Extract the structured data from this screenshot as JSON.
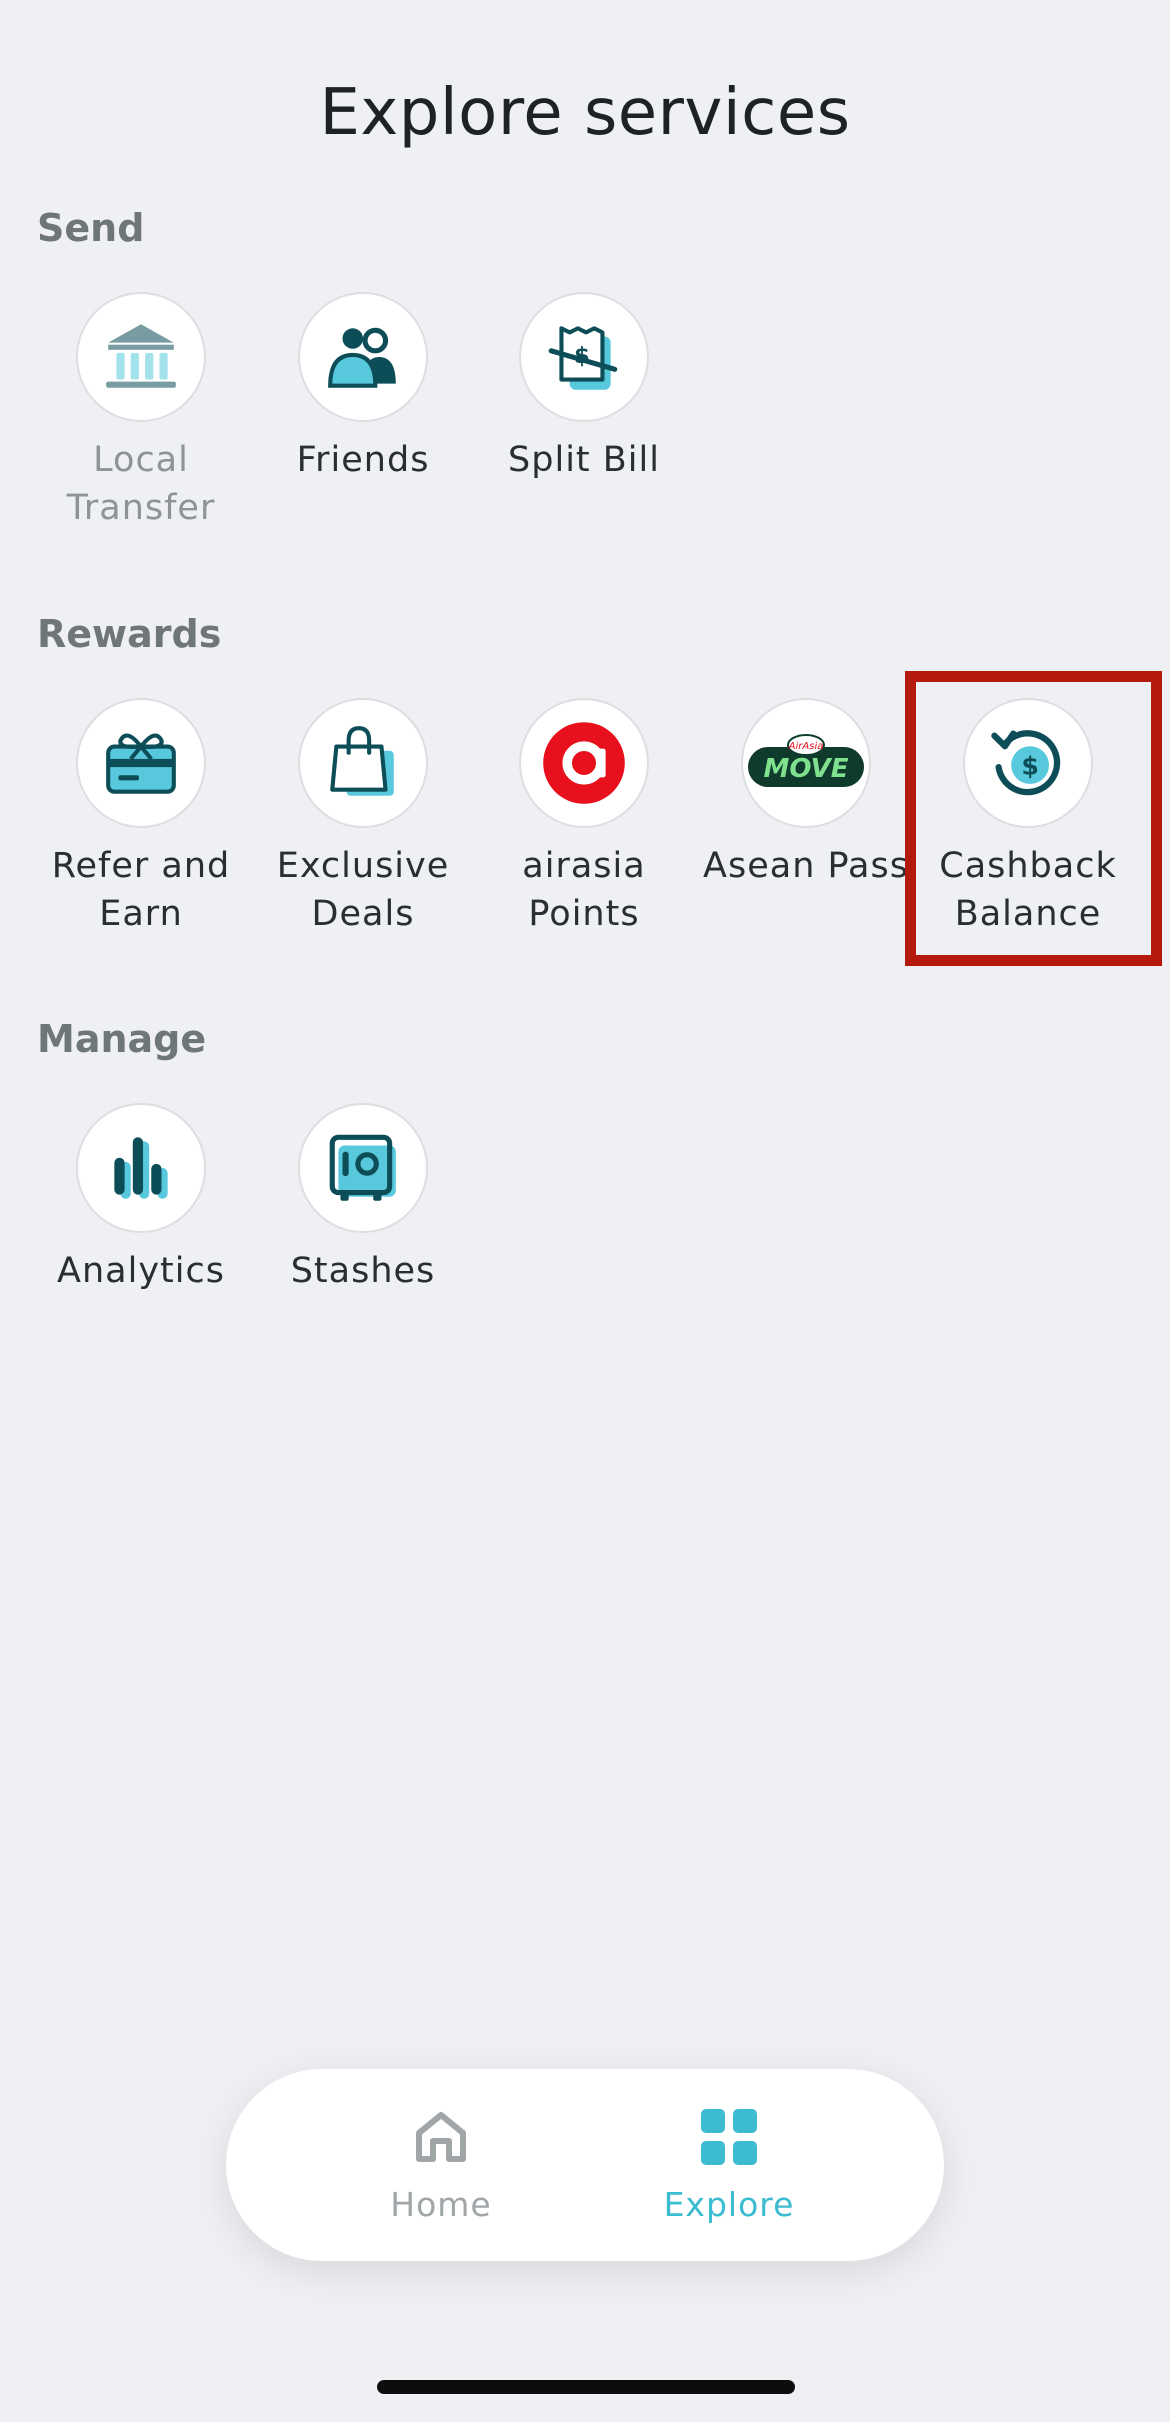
{
  "header": {
    "title": "Explore services"
  },
  "sections": {
    "send": {
      "title": "Send",
      "items": [
        {
          "label": "Local\nTransfer",
          "icon": "bank-icon",
          "disabled": true
        },
        {
          "label": "Friends",
          "icon": "friends-icon"
        },
        {
          "label": "Split Bill",
          "icon": "split-bill-icon"
        }
      ]
    },
    "rewards": {
      "title": "Rewards",
      "items": [
        {
          "label": "Refer and\nEarn",
          "icon": "gift-card-icon"
        },
        {
          "label": "Exclusive\nDeals",
          "icon": "shopping-bag-icon"
        },
        {
          "label": "airasia\nPoints",
          "icon": "airasia-logo-icon"
        },
        {
          "label": "Asean Pass",
          "icon": "move-logo-icon"
        },
        {
          "label": "Cashback\nBalance",
          "icon": "cashback-icon"
        }
      ]
    },
    "manage": {
      "title": "Manage",
      "items": [
        {
          "label": "Analytics",
          "icon": "bar-chart-icon"
        },
        {
          "label": "Stashes",
          "icon": "safe-icon"
        }
      ]
    }
  },
  "logos": {
    "move_text": "MOVE",
    "move_badge": "AirAsia"
  },
  "bottom_nav": {
    "items": [
      {
        "label": "Home",
        "icon": "home-icon",
        "active": false
      },
      {
        "label": "Explore",
        "icon": "grid-icon",
        "active": true
      }
    ]
  },
  "colors": {
    "accent": "#3bbcd0",
    "dark_teal": "#0d4d57",
    "light_teal": "#58c9dc",
    "highlight": "#b5190e",
    "inactive": "#a0a5a8"
  }
}
